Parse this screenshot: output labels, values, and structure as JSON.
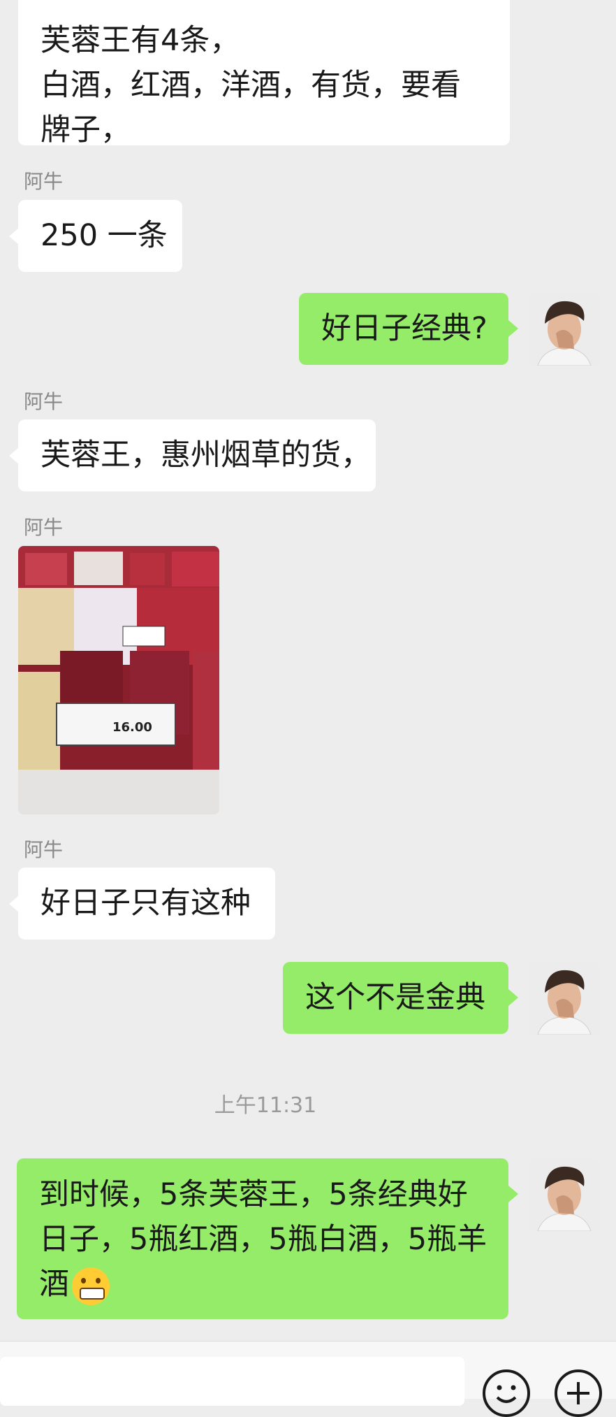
{
  "chat": {
    "messages": [
      {
        "side": "left",
        "text": "芙蓉王有4条，\n白酒，红酒，洋酒，有货，要看牌子，"
      },
      {
        "side": "left",
        "sender": "阿牛",
        "text": "250 一条"
      },
      {
        "side": "right",
        "text": "好日子经典?"
      },
      {
        "side": "left",
        "sender": "阿牛",
        "text": "芙蓉王，惠州烟草的货，"
      },
      {
        "side": "left",
        "sender": "阿牛",
        "type": "image",
        "image_text": "16.00"
      },
      {
        "side": "left",
        "sender": "阿牛",
        "text": "好日子只有这种"
      },
      {
        "side": "right",
        "text": "这个不是金典"
      },
      {
        "side": "right",
        "text": "到时候，5条芙蓉王，5条经典好日子，5瓶红酒，5瓶白酒，5瓶羊酒",
        "emoji": "grimacing-face"
      }
    ],
    "timestamp": "上午11:31"
  },
  "input_bar": {
    "icons": [
      "emoji-icon",
      "plus-icon"
    ]
  }
}
